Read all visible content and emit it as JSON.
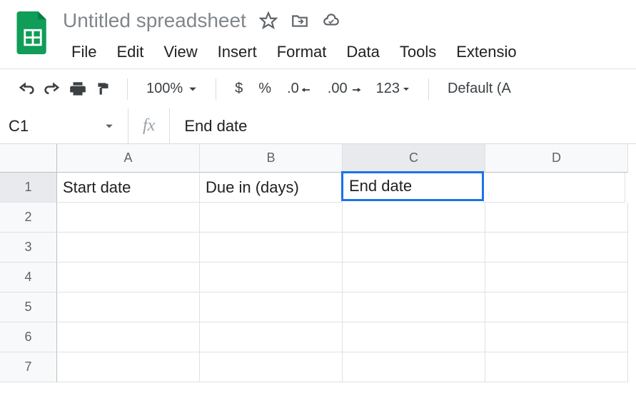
{
  "document": {
    "title": "Untitled spreadsheet"
  },
  "menu": {
    "file": "File",
    "edit": "Edit",
    "view": "View",
    "insert": "Insert",
    "format": "Format",
    "data": "Data",
    "tools": "Tools",
    "extensions": "Extensio"
  },
  "toolbar": {
    "zoom": "100%",
    "currency": "$",
    "percent": "%",
    "decimal_decrease": ".0",
    "decimal_increase": ".00",
    "more_formats": "123",
    "font": "Default (A"
  },
  "formula_bar": {
    "cell_ref": "C1",
    "fx": "fx",
    "formula_value": "End date"
  },
  "grid": {
    "columns": [
      "A",
      "B",
      "C",
      "D"
    ],
    "rows": [
      "1",
      "2",
      "3",
      "4",
      "5",
      "6",
      "7"
    ],
    "selected_cell": "C1",
    "cells": {
      "A1": "Start date",
      "B1": "Due in (days)",
      "C1": "End date"
    }
  }
}
